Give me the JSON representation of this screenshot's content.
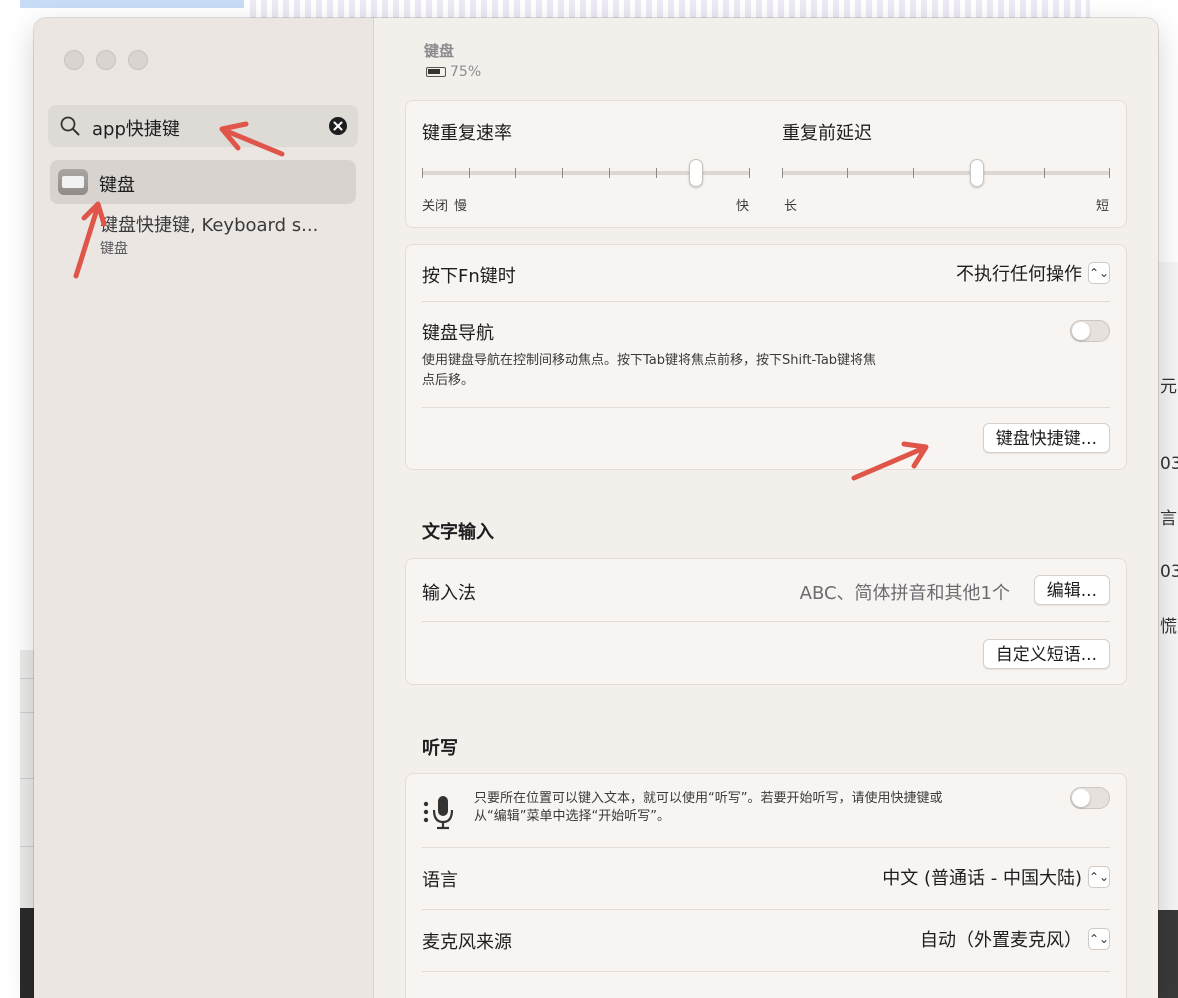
{
  "sidebar": {
    "search": {
      "value": "app快捷键"
    },
    "result": {
      "label": "键盘",
      "sub_title": "键盘快捷键, Keyboard s...",
      "sub_caption": "键盘"
    }
  },
  "header": {
    "title": "键盘",
    "battery": "75%"
  },
  "repeat": {
    "rate_label": "键重复速率",
    "rate_left_1": "关闭",
    "rate_left_2": "慢",
    "rate_right": "快",
    "rate_value": 0.85,
    "delay_label": "重复前延迟",
    "delay_left": "长",
    "delay_right": "短",
    "delay_value": 0.6
  },
  "fn": {
    "label": "按下Fn键时",
    "value": "不执行任何操作"
  },
  "nav": {
    "label": "键盘导航",
    "desc_1": "使用键盘导航在控制间移动焦点。按下Tab键将焦点前移，按下Shift-Tab键将焦",
    "desc_2": "点后移。",
    "enabled": false
  },
  "shortcuts_button": "键盘快捷键...",
  "text_input": {
    "title": "文字输入",
    "ime_label": "输入法",
    "ime_value": "ABC、简体拼音和其他1个",
    "edit_button": "编辑...",
    "phrases_button": "自定义短语..."
  },
  "dictation": {
    "title": "听写",
    "desc_1": "只要所在位置可以键入文本，就可以使用“听写”。若要开始听写，请使用快捷键或",
    "desc_2": "从“编辑”菜单中选择“开始听写”。",
    "enabled": false,
    "language_label": "语言",
    "language_value": "中文 (普通话 - 中国大陆)",
    "mic_label": "麦克风来源",
    "mic_value": "自动（外置麦克风）"
  },
  "background": {
    "right_fragments": [
      "元",
      "03",
      "言",
      "03",
      "慌"
    ]
  },
  "colors": {
    "annotation_arrow": "#e0554a",
    "window_bg": "#f3efeb",
    "sidebar_bg": "#ebe6e1"
  }
}
